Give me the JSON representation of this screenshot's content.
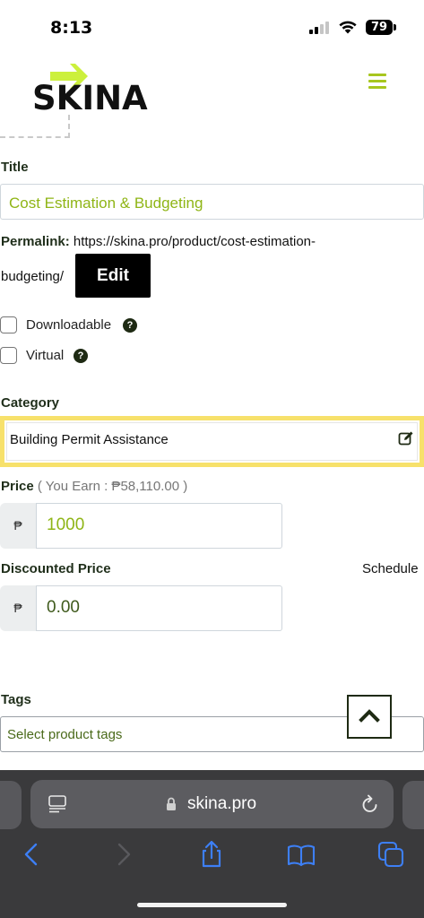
{
  "status_bar": {
    "time": "8:13",
    "battery": "79"
  },
  "header": {
    "logo_text": "SKINA",
    "logo_accent_color": "#ccf03c",
    "menu_color": "#a7c61e"
  },
  "form": {
    "title_label": "Title",
    "title_value": "Cost Estimation & Budgeting",
    "permalink_label": "Permalink:",
    "permalink_url_line1": "https://skina.pro/product/cost-estimation-",
    "permalink_url_line2": "budgeting/",
    "edit_button": "Edit",
    "downloadable_label": "Downloadable",
    "virtual_label": "Virtual",
    "help_glyph": "?",
    "category_label": "Category",
    "category_value": "Building Permit Assistance",
    "category_highlight_color": "#f7e16b",
    "price_label": "Price",
    "price_note": "( You Earn : ₱58,110.00 )",
    "currency_symbol": "₱",
    "price_value": "1000",
    "discount_label": "Discounted Price",
    "schedule_link": "Schedule",
    "discount_value": "0.00",
    "tags_label": "Tags",
    "tags_placeholder": "Select product tags"
  },
  "browser": {
    "url": "skina.pro",
    "icons": [
      "reader-icon",
      "lock-icon",
      "reload-icon",
      "back-icon",
      "forward-icon",
      "share-icon",
      "bookmarks-icon",
      "tabs-icon"
    ],
    "accent_color": "#3d7ff5"
  }
}
